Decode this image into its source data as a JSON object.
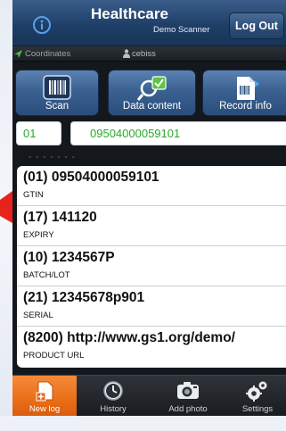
{
  "header": {
    "title": "Healthcare",
    "subtitle": "Demo Scanner",
    "logout_label": "Log Out",
    "info_icon": "info-icon"
  },
  "status": {
    "coordinates_label": "Coordinates",
    "user_label": "cebiss"
  },
  "actions": [
    {
      "label": "Scan",
      "icon": "barcode-icon"
    },
    {
      "label": "Data content",
      "icon": "search-check-icon"
    },
    {
      "label": "Record info",
      "icon": "document-barcode-icon"
    }
  ],
  "input": {
    "ai_value": "01",
    "code_value": "09504000059101"
  },
  "separator": "- - - - - - -",
  "results": [
    {
      "value": "(01) 09504000059101",
      "label": "GTIN"
    },
    {
      "value": "(17) 141120",
      "label": "EXPIRY"
    },
    {
      "value": "(10) 1234567P",
      "label": "BATCH/LOT"
    },
    {
      "value": "(21) 12345678p901",
      "label": "SERIAL"
    },
    {
      "value": "(8200) http://www.gs1.org/demo/",
      "label": "PRODUCT URL"
    }
  ],
  "tabs": [
    {
      "label": "New log",
      "icon": "new-log-icon",
      "active": true
    },
    {
      "label": "History",
      "icon": "clock-icon",
      "active": false
    },
    {
      "label": "Add photo",
      "icon": "camera-icon",
      "active": false
    },
    {
      "label": "Settings",
      "icon": "gears-icon",
      "active": false
    }
  ],
  "colors": {
    "titlebar": "#1f3f68",
    "accent_orange": "#ea6d18",
    "input_text": "#2aa82a",
    "button_blue": "#3b6191"
  }
}
